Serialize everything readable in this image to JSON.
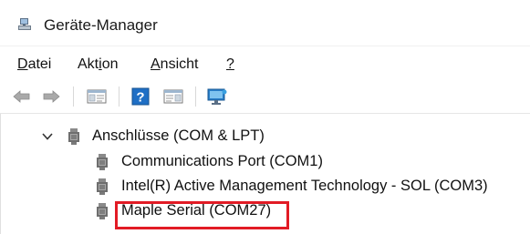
{
  "window": {
    "title": "Geräte-Manager"
  },
  "menubar": {
    "items": [
      {
        "label": "Datei"
      },
      {
        "label": "Aktion"
      },
      {
        "label": "Ansicht"
      },
      {
        "label": "?"
      }
    ]
  },
  "toolbar": {
    "buttons": [
      {
        "icon": "back-arrow-icon"
      },
      {
        "icon": "forward-arrow-icon"
      },
      {
        "icon": "properties-pane-icon"
      },
      {
        "icon": "help-icon"
      },
      {
        "icon": "action-pane-icon"
      },
      {
        "icon": "monitor-icon"
      }
    ]
  },
  "tree": {
    "category": {
      "label": "Anschlüsse (COM & LPT)",
      "expanded": true
    },
    "devices": [
      {
        "label": "Communications Port (COM1)"
      },
      {
        "label": "Intel(R) Active Management Technology - SOL (COM3)"
      },
      {
        "label": "Maple Serial (COM27)",
        "highlighted": true
      }
    ]
  },
  "colors": {
    "highlight_border": "#e21b25",
    "accent_blue": "#1f6fc5"
  }
}
